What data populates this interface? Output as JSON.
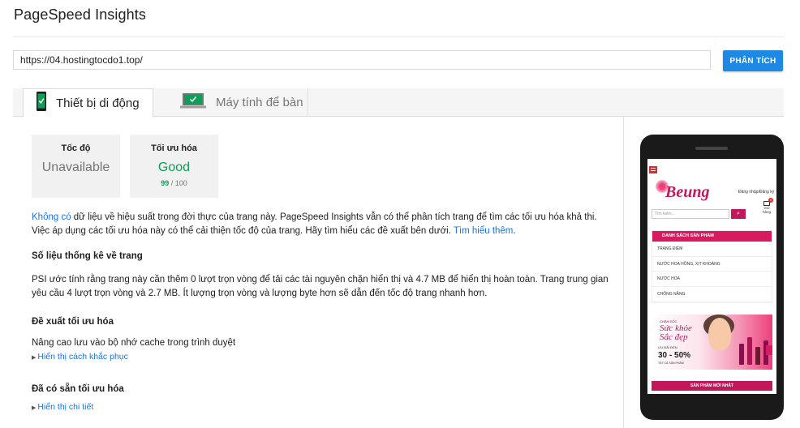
{
  "app": {
    "title": "PageSpeed Insights"
  },
  "search": {
    "url": "https://04.hostingtocdo1.top/",
    "analyze_label": "PHÂN TÍCH"
  },
  "tabs": [
    {
      "label": "Thiết bị di động",
      "icon": "mobile-phone-icon",
      "active": true
    },
    {
      "label": "Máy tính để bàn",
      "icon": "desktop-monitor-icon",
      "active": false
    }
  ],
  "scores": {
    "speed": {
      "label": "Tốc độ",
      "value": "Unavailable"
    },
    "optimization": {
      "label": "Tối ưu hóa",
      "value": "Good",
      "score": "99",
      "max": "/ 100"
    }
  },
  "intro": {
    "link1": "Không có",
    "text": " dữ liệu về hiệu suất trong đời thực của trang này. PageSpeed Insights vẫn có thể phân tích trang để tìm các tối ưu hóa khả thi. Việc áp dụng các tối ưu hóa này có thể cải thiện tốc độ của trang. Hãy tìm hiểu các đề xuất bên dưới. ",
    "link2": "Tìm hiểu thêm",
    "end": "."
  },
  "stats": {
    "heading": "Số liệu thống kê về trang",
    "text": "PSI ước tính rằng trang này cần thêm 0 lượt trọn vòng để tải các tài nguyên chặn hiển thị và 4.7 MB để hiển thị hoàn toàn. Trang trung gian yêu cầu 4 lượt trọn vòng và 2.7 MB. Ít lượng trọn vòng và lượng byte hơn sẽ dẫn đến tốc độ trang nhanh hơn."
  },
  "suggestions": {
    "heading": "Đề xuất tối ưu hóa",
    "item": "Nâng cao lưu vào bộ nhớ cache trong trình duyệt",
    "link": "Hiển thị cách khắc phục"
  },
  "existing": {
    "heading": "Đã có sẵn tối ưu hóa",
    "link": "Hiển thị chi tiết"
  },
  "preview": {
    "logo": "Beung",
    "login": "Đăng nhập/Đăng ký",
    "cart_count": "0",
    "cart_label": "Giỏ hàng",
    "search_placeholder": "Tìm kiếm...",
    "category_heading": "DANH SÁCH SẢN PHẨM",
    "categories": [
      "TRANG ĐIỂM",
      "NƯỚC HOA HỒNG, XỊT KHOÁNG",
      "NƯỚC HOA",
      "CHỐNG NẮNG"
    ],
    "banner_small": "CHĂM SÓC",
    "banner_title_1": "Sức khỏe",
    "banner_title_2": "Sắc đẹp",
    "banner_sub": "ƯU ĐÃI ĐẾN",
    "banner_pct": "30 - 50%",
    "banner_note": "TẤT CẢ SẢN PHẨM",
    "new_products": "SẢN PHẨM MỚI NHẤT"
  }
}
